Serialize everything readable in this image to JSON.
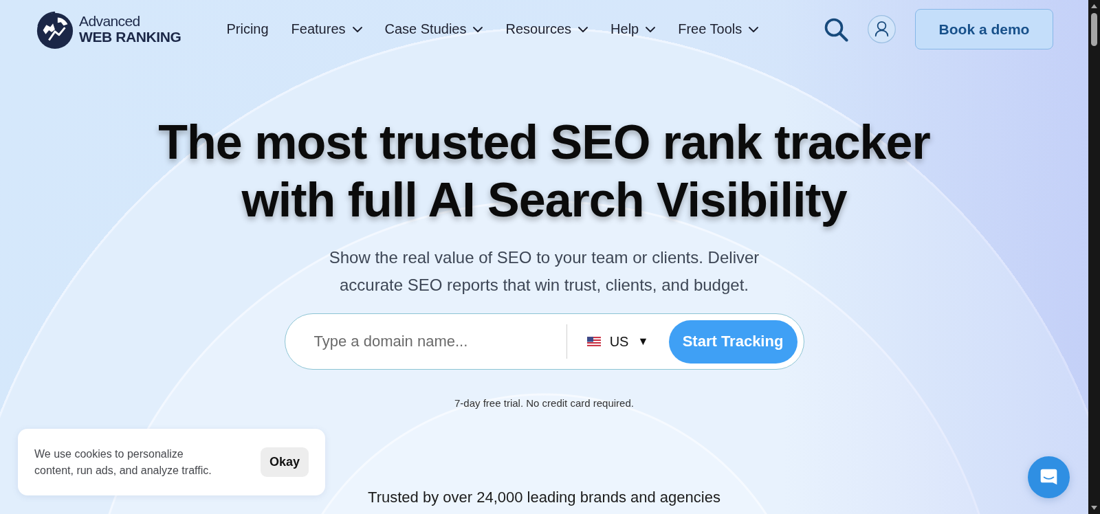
{
  "header": {
    "logo": {
      "line_1": "Advanced",
      "line_2": "WEB RANKING"
    },
    "nav": [
      {
        "label": "Pricing",
        "has_dropdown": false
      },
      {
        "label": "Features",
        "has_dropdown": true
      },
      {
        "label": "Case Studies",
        "has_dropdown": true
      },
      {
        "label": "Resources",
        "has_dropdown": true
      },
      {
        "label": "Help",
        "has_dropdown": true
      },
      {
        "label": "Free Tools",
        "has_dropdown": true
      }
    ],
    "cta": "Book a demo"
  },
  "hero": {
    "headline": "The most trusted SEO rank tracker with full AI Search Visibility",
    "subtitle": "Show the real value of SEO to your team or clients. Deliver accurate SEO reports that win trust, clients, and budget.",
    "search": {
      "placeholder": "Type a domain name...",
      "country": "US",
      "caret": "▼",
      "button": "Start Tracking"
    },
    "note": "7-day free trial. No credit card required."
  },
  "trusted": "Trusted by over 24,000 leading brands and agencies",
  "cookie_banner": {
    "text": "We use cookies to personalize content, run ads, and analyze traffic.",
    "button": "Okay"
  }
}
